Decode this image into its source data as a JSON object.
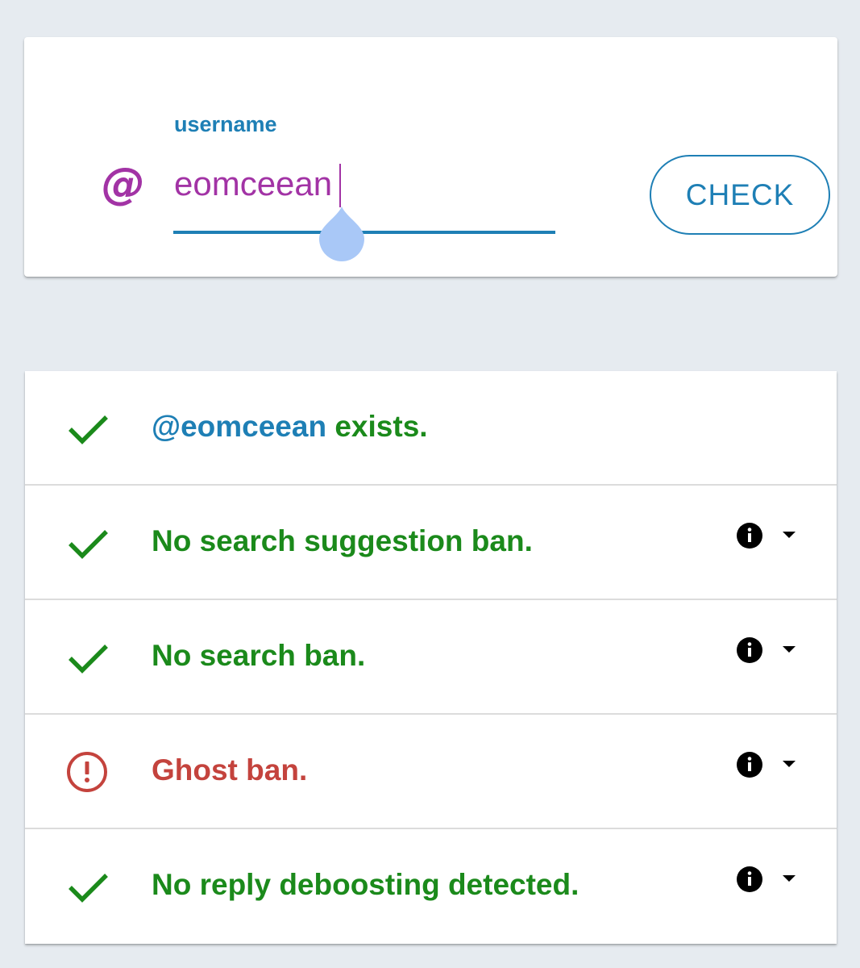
{
  "form": {
    "field_label": "username",
    "at_symbol": "@",
    "username_value": "eomceean",
    "check_label": "CHECK"
  },
  "results": {
    "exists": {
      "handle": "@eomceean",
      "suffix": " exists.",
      "status": "ok"
    },
    "items": [
      {
        "label": "No search suggestion ban.",
        "status": "ok"
      },
      {
        "label": "No search ban.",
        "status": "ok"
      },
      {
        "label": "Ghost ban.",
        "status": "bad"
      },
      {
        "label": "No reply deboosting detected.",
        "status": "ok"
      }
    ]
  },
  "colors": {
    "ok": "#1b8a1b",
    "bad": "#c4433d",
    "accent": "#1e7fb5",
    "input_text": "#a233a5"
  },
  "icons": {
    "ok": "check-icon",
    "bad": "alert-circle-icon",
    "info": "info-icon",
    "expand": "caret-down-icon"
  }
}
